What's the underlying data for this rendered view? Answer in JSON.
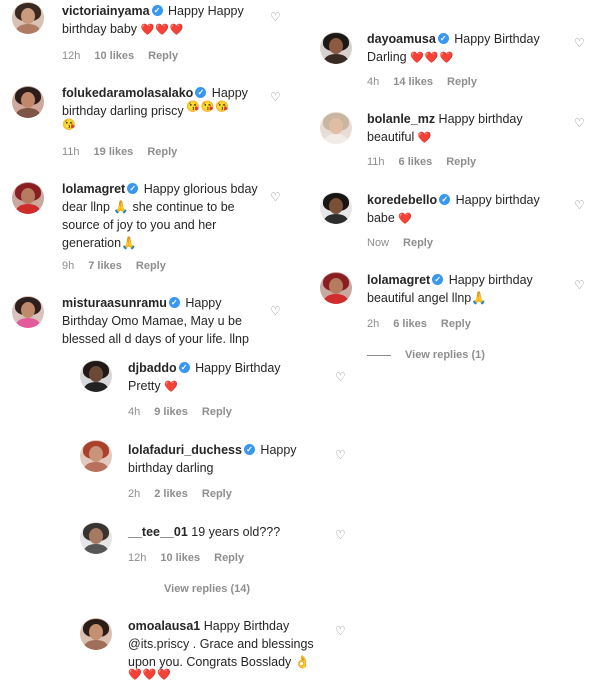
{
  "comments_left": [
    {
      "id": "c1",
      "user": "victoriainyama",
      "verified": true,
      "text": " Happy Happy birthday baby ",
      "emoji": "❤️❤️❤️",
      "time": "12h",
      "likes": "10 likes",
      "reply": "Reply"
    },
    {
      "id": "c2",
      "user": "folukedaramolasalako",
      "verified": true,
      "text": " Happy birthday darling priscy",
      "emoji": "😘😘😘 😘",
      "time": "11h",
      "likes": "19 likes",
      "reply": "Reply"
    },
    {
      "id": "c3",
      "user": "lolamagret",
      "verified": true,
      "text": " Happy glorious bday dear llnp 🙏 she continue to be source of joy to you and her generation🙏",
      "emoji": "",
      "time": "9h",
      "likes": "7 likes",
      "reply": "Reply"
    },
    {
      "id": "c4",
      "user": "misturaasunramu",
      "verified": true,
      "text": " Happy Birthday Omo Mamae, May u be blessed all d days of your life. llnp",
      "emoji": "",
      "time": "",
      "likes": "",
      "reply": ""
    }
  ],
  "replies_left": [
    {
      "id": "r1",
      "user": "djbaddo",
      "verified": true,
      "text": " Happy Birthday Pretty ",
      "emoji": "❤️",
      "time": "4h",
      "likes": "9 likes",
      "reply": "Reply"
    },
    {
      "id": "r2",
      "user": "lolafaduri_duchess",
      "verified": true,
      "text": " Happy birthday darling",
      "emoji": "",
      "time": "2h",
      "likes": "2 likes",
      "reply": "Reply"
    },
    {
      "id": "r3",
      "user": "__tee__01",
      "verified": false,
      "text": " 19 years old???",
      "emoji": "",
      "time": "12h",
      "likes": "10 likes",
      "reply": "Reply"
    },
    {
      "id": "r4",
      "user": "omoalausa1",
      "verified": false,
      "text": " Happy Birthday @its.priscy . Grace and blessings upon you. Congrats Bosslady 👌",
      "emoji": "❤️❤️❤️",
      "time": "",
      "likes": "",
      "reply": ""
    }
  ],
  "view_replies_left": "View replies (14)",
  "comments_right": [
    {
      "id": "c5",
      "user": "dayoamusa",
      "verified": true,
      "text": " Happy Birthday Darling ",
      "emoji": "❤️❤️❤️",
      "time": "4h",
      "likes": "14 likes",
      "reply": "Reply"
    },
    {
      "id": "c6",
      "user": "bolanle_mz",
      "verified": false,
      "text": " Happy birthday beautiful ",
      "emoji": "❤️",
      "time": "11h",
      "likes": "6 likes",
      "reply": "Reply"
    },
    {
      "id": "c7",
      "user": "koredebello",
      "verified": true,
      "text": " Happy birthday babe ",
      "emoji": "❤️",
      "time": "Now",
      "likes": "",
      "reply": "Reply"
    },
    {
      "id": "c8",
      "user": "lolamagret",
      "verified": true,
      "text": " Happy birthday beautiful angel llnp🙏",
      "emoji": "",
      "time": "2h",
      "likes": "6 likes",
      "reply": "Reply"
    }
  ],
  "view_replies_right": "View replies (1)",
  "icons": {
    "like": "heart-outline-icon",
    "verified": "verified-badge-icon"
  },
  "colors": {
    "verified": "#3897f0",
    "meta": "#8e8e8e",
    "heart": "#e0245e"
  }
}
